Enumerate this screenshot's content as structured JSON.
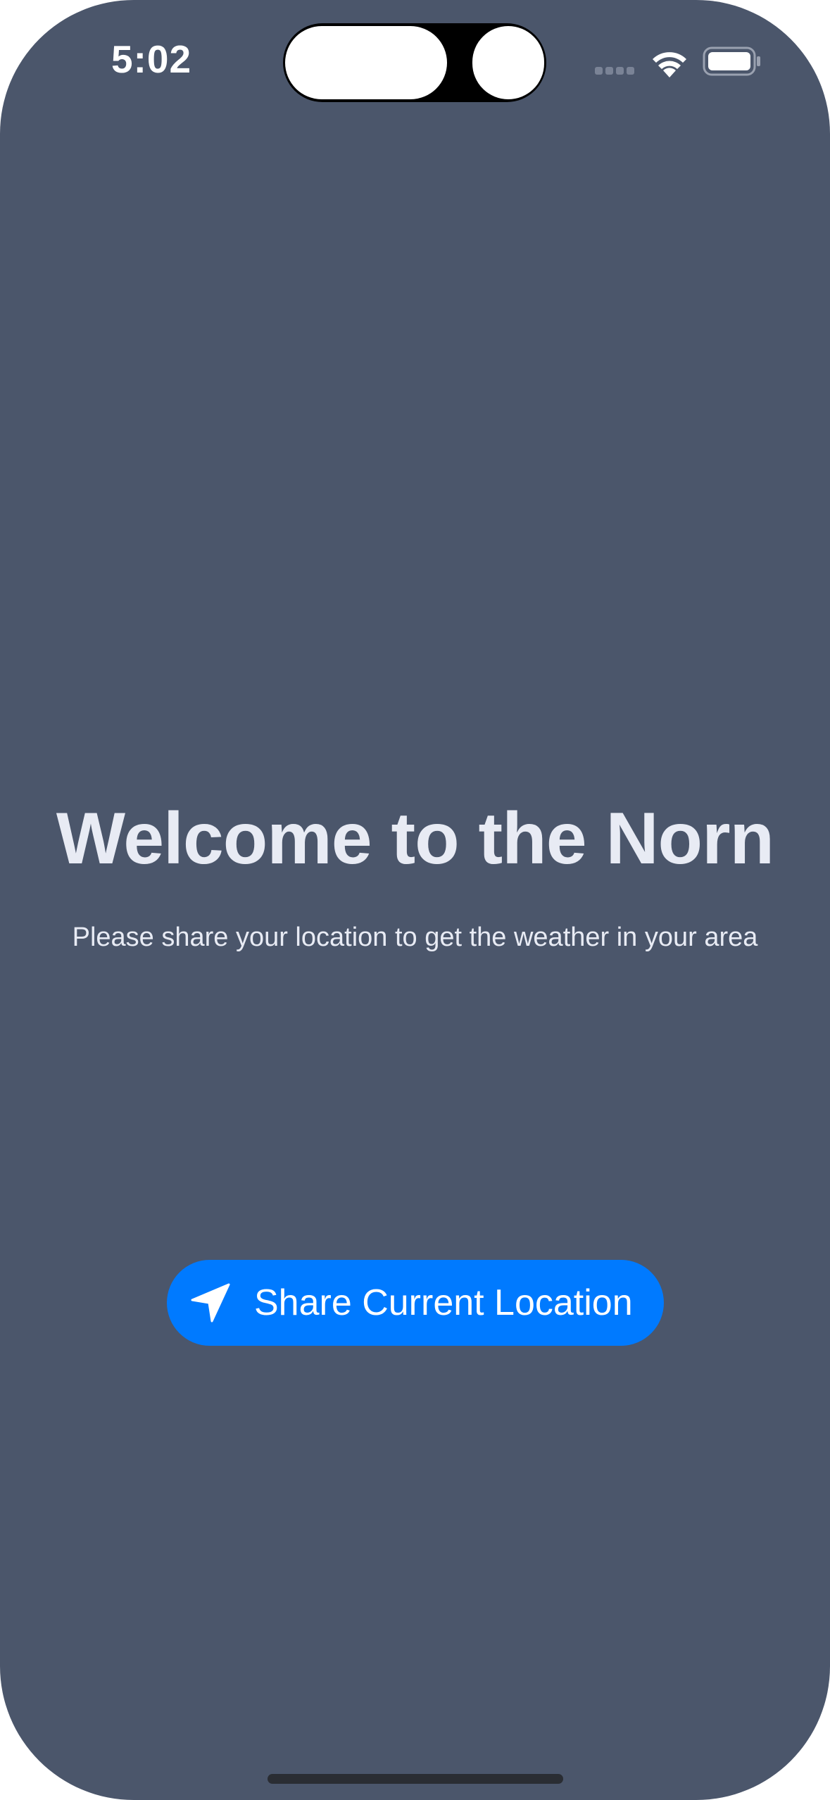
{
  "status_bar": {
    "time": "5:02",
    "signal_icon": "cellular-signal-icon",
    "wifi_icon": "wifi-icon",
    "battery_icon": "battery-icon"
  },
  "main": {
    "title": "Welcome to the Norn",
    "subtitle": "Please share your location to get the weather in your area",
    "share_button": {
      "icon": "location-arrow-icon",
      "label": "Share Current Location"
    }
  },
  "colors": {
    "background": "#4b566b",
    "accent": "#007aff",
    "text": "#e8ebf4"
  }
}
